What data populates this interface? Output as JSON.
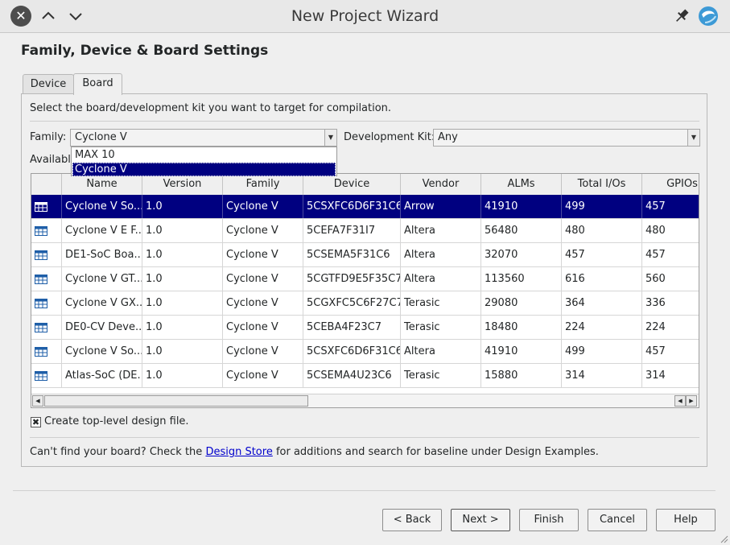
{
  "window": {
    "title": "New Project Wizard",
    "close_glyph": "✕",
    "icons": [
      "close-icon",
      "chevron-up-icon",
      "chevron-down-icon",
      "pin-icon",
      "app-logo-icon"
    ]
  },
  "page": {
    "heading": "Family, Device & Board Settings"
  },
  "tabs": [
    {
      "label": "Device",
      "active": false
    },
    {
      "label": "Board",
      "active": true
    }
  ],
  "board_tab": {
    "instruction": "Select the board/development kit you want to target for compilation.",
    "family_label": "Family:",
    "family_value": "Cyclone V",
    "family_options": [
      "MAX 10",
      "Cyclone V"
    ],
    "devkit_label": "Development Kit:",
    "devkit_value": "Any",
    "available_label_partial": "Availabl"
  },
  "table": {
    "columns": [
      "",
      "Name",
      "Version",
      "Family",
      "Device",
      "Vendor",
      "ALMs",
      "Total I/Os",
      "GPIOs"
    ],
    "rows": [
      {
        "name": "Cyclone V So...",
        "version": "1.0",
        "family": "Cyclone V",
        "device": "5CSXFC6D6F31C6",
        "vendor": "Arrow",
        "alms": "41910",
        "total_ios": "499",
        "gpios": "457"
      },
      {
        "name": "Cyclone V E F...",
        "version": "1.0",
        "family": "Cyclone V",
        "device": "5CEFA7F31I7",
        "vendor": "Altera",
        "alms": "56480",
        "total_ios": "480",
        "gpios": "480"
      },
      {
        "name": "DE1-SoC Boa...",
        "version": "1.0",
        "family": "Cyclone V",
        "device": "5CSEMA5F31C6",
        "vendor": "Altera",
        "alms": "32070",
        "total_ios": "457",
        "gpios": "457"
      },
      {
        "name": "Cyclone V GT...",
        "version": "1.0",
        "family": "Cyclone V",
        "device": "5CGTFD9E5F35C7",
        "vendor": "Altera",
        "alms": "113560",
        "total_ios": "616",
        "gpios": "560"
      },
      {
        "name": "Cyclone V GX...",
        "version": "1.0",
        "family": "Cyclone V",
        "device": "5CGXFC5C6F27C7",
        "vendor": "Terasic",
        "alms": "29080",
        "total_ios": "364",
        "gpios": "336"
      },
      {
        "name": "DE0-CV Deve...",
        "version": "1.0",
        "family": "Cyclone V",
        "device": "5CEBA4F23C7",
        "vendor": "Terasic",
        "alms": "18480",
        "total_ios": "224",
        "gpios": "224"
      },
      {
        "name": "Cyclone V So...",
        "version": "1.0",
        "family": "Cyclone V",
        "device": "5CSXFC6D6F31C6",
        "vendor": "Altera",
        "alms": "41910",
        "total_ios": "499",
        "gpios": "457"
      },
      {
        "name": "Atlas-SoC (DE...",
        "version": "1.0",
        "family": "Cyclone V",
        "device": "5CSEMA4U23C6",
        "vendor": "Terasic",
        "alms": "15880",
        "total_ios": "314",
        "gpios": "314"
      }
    ],
    "selected_row": 0,
    "scroll_left_glyph": "◀",
    "scroll_right_glyph": "▶"
  },
  "options": {
    "create_toplevel_label": "Create top-level design file.",
    "create_toplevel_checked": true,
    "check_glyph": "✖"
  },
  "footer_note": {
    "prefix": "Can't find your board? Check the ",
    "link": "Design Store",
    "suffix": " for additions and search for baseline under Design Examples."
  },
  "buttons": {
    "back": "< Back",
    "next": "Next >",
    "finish": "Finish",
    "cancel": "Cancel",
    "help": "Help"
  },
  "colors": {
    "selection": "#000080",
    "link": "#0000cc",
    "logo_blue": "#3d9ad6"
  }
}
